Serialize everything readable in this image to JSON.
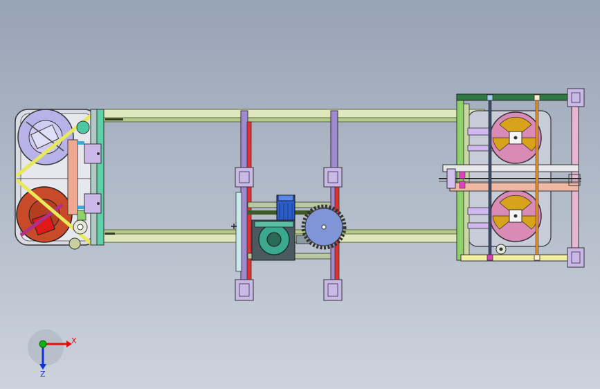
{
  "view": {
    "triad": {
      "x_label": "X",
      "z_label": "Z"
    }
  },
  "colors": {
    "background_top": "#97a3b6",
    "background_bottom": "#cdd3dc",
    "frame_rail": "#d8e6b2",
    "frame_rail_dark": "#6a7f44",
    "green_bar": "#8ed16a",
    "teal_bar": "#5fd1a8",
    "purple_post": "#a08ad0",
    "red_post": "#e03030",
    "pulley_lavender": "#b9b2e8",
    "pulley_red": "#c84a28",
    "pink_wheel": "#d98bb6",
    "orange_segment": "#d8a21a",
    "gear_blue": "#8094d8",
    "gearbox_teal": "#3aa98e",
    "motor_blue": "#2c5cc8",
    "yellow_strap": "#e8e85a",
    "dark_green_bar": "#2f7a44",
    "pink_panel": "#e6b6d2",
    "salmon_panel": "#f0b8a4",
    "triad_x": "#e01010",
    "triad_y": "#10b010",
    "triad_z": "#1030e0"
  },
  "icons": {
    "triad": "coordinate-triad-icon"
  }
}
